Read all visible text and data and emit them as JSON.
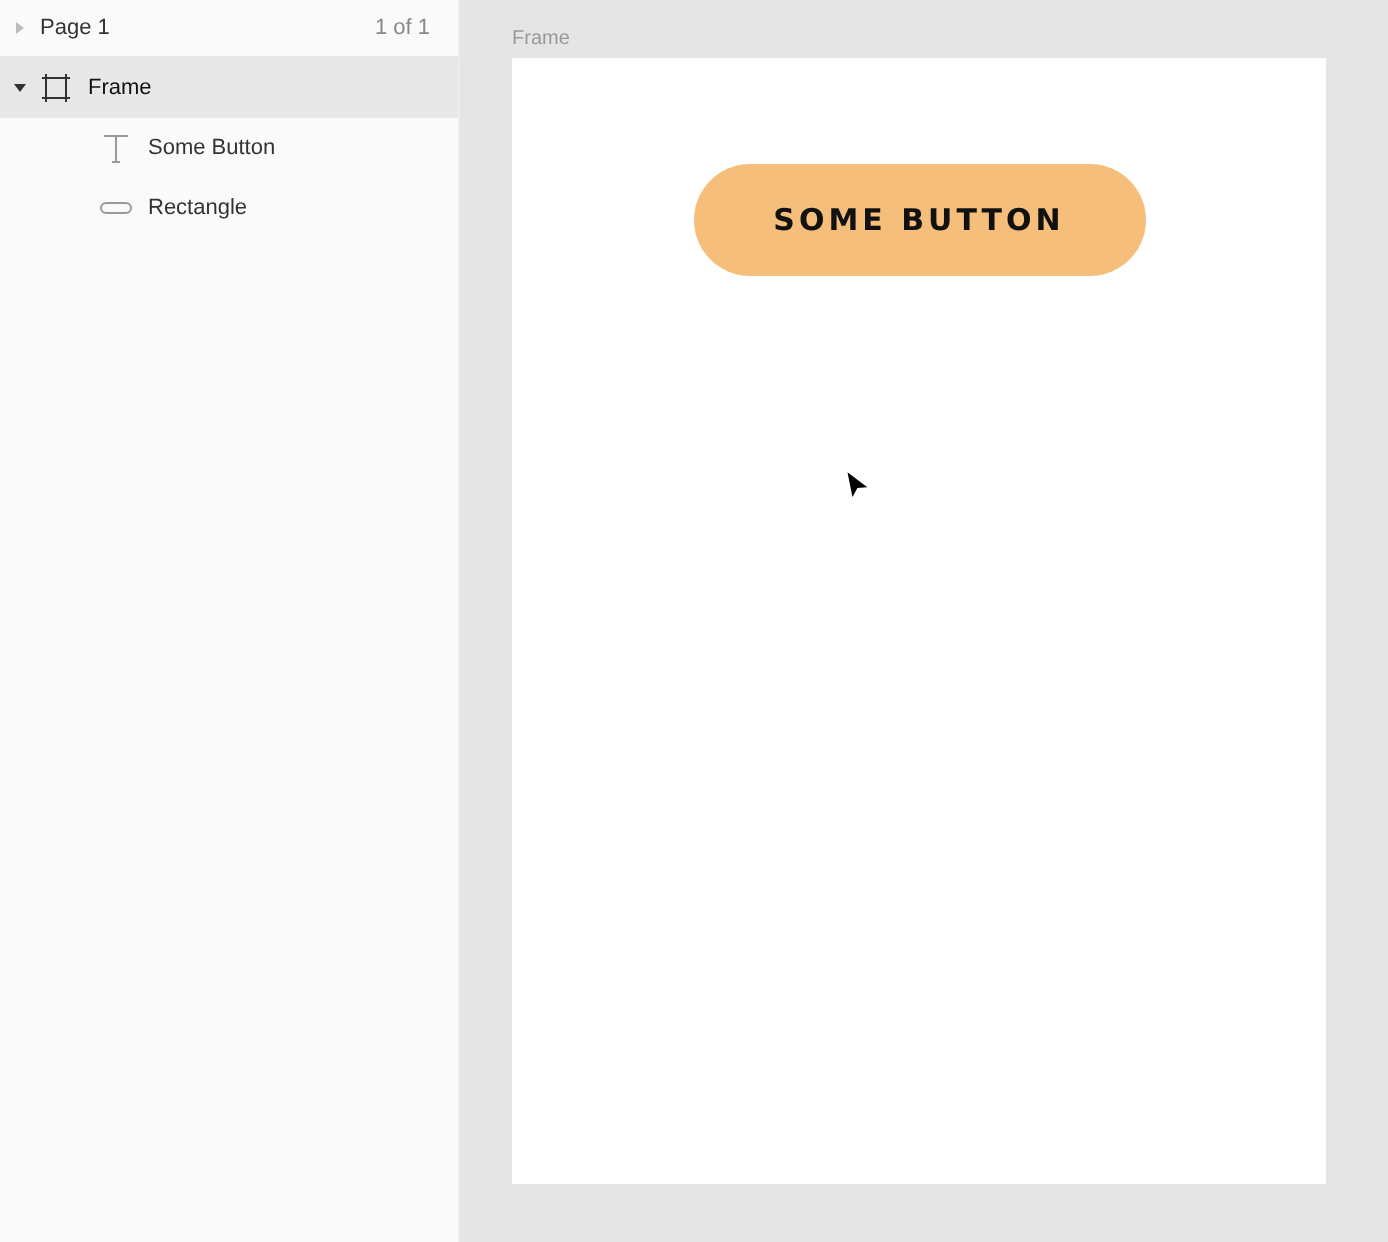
{
  "page": {
    "label": "Page 1",
    "count": "1 of 1",
    "expanded": false
  },
  "layers": [
    {
      "name": "Frame",
      "kind": "frame",
      "selected": true,
      "expanded": true,
      "children": [
        {
          "name": "Some Button",
          "kind": "text",
          "selected": false
        },
        {
          "name": "Rectangle",
          "kind": "rectangle",
          "selected": false
        }
      ]
    }
  ],
  "canvas": {
    "frame_label": "Frame",
    "button_label": "SOME BUTTON"
  }
}
